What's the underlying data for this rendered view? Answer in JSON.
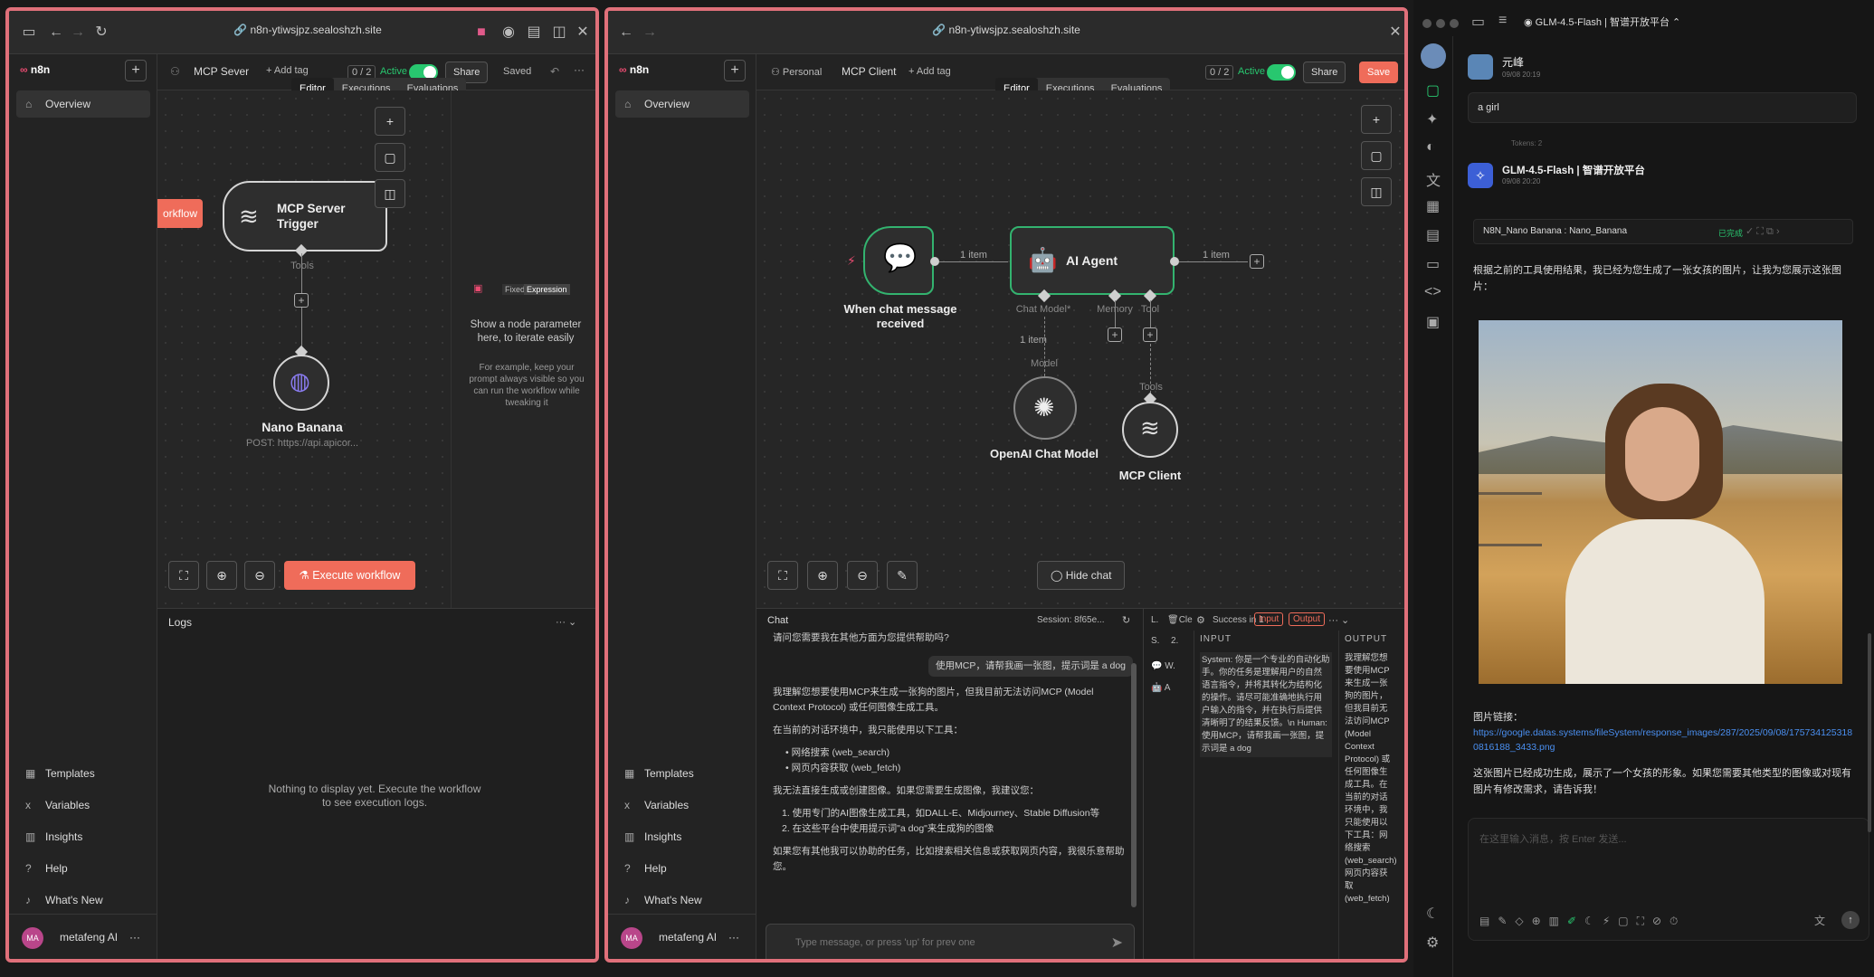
{
  "left_window": {
    "url": "n8n-ytiwsjpz.sealoshzh.site",
    "logo": "n8n",
    "nav_overview": "Overview",
    "workflow_name": "MCP Sever",
    "add_tag": "+ Add tag",
    "counter": "0 / 2",
    "active": "Active",
    "share": "Share",
    "saved": "Saved",
    "tabs": [
      "Editor",
      "Executions",
      "Evaluations"
    ],
    "workflow_tab": "orkflow",
    "node_trigger": "MCP Server Trigger",
    "tools_label": "Tools",
    "node_nano": "Nano Banana",
    "node_nano_sub": "POST: https://api.apicor...",
    "fixed": "Fixed",
    "expression": "Expression",
    "hint_title": "Show a node parameter here, to iterate easily",
    "hint_body": "For example, keep your prompt always visible so you can run the workflow while tweaking it",
    "execute": "Execute workflow",
    "logs": "Logs",
    "logs_empty": "Nothing to display yet. Execute the workflow to see execution logs.",
    "bottom_nav": [
      "Templates",
      "Variables",
      "Insights",
      "Help",
      "What's New"
    ],
    "user": "metafeng AI",
    "avatar": "MA"
  },
  "mid_window": {
    "url": "n8n-ytiwsjpz.sealoshzh.site",
    "logo": "n8n",
    "nav_overview": "Overview",
    "personal": "Personal",
    "workflow_name": "MCP Client",
    "add_tag": "+ Add tag",
    "counter": "0 / 2",
    "active": "Active",
    "share": "Share",
    "save": "Save",
    "tabs": [
      "Editor",
      "Executions",
      "Evaluations"
    ],
    "node_chat": "When chat message received",
    "item1": "1 item",
    "node_agent": "AI Agent",
    "item2": "1 item",
    "port_chat_model": "Chat Model*",
    "port_memory": "Memory",
    "port_tool": "Tool",
    "item3": "1 item",
    "model_label": "Model",
    "tools_label": "Tools",
    "node_openai": "OpenAI Chat Model",
    "node_mcp": "MCP Client",
    "hide_chat": "Hide chat",
    "chat_title": "Chat",
    "session": "Session: 8f65e...",
    "msg_bot1": "请问您需要我在其他方面为您提供帮助吗?",
    "msg_user": "使用MCP，请帮我画一张图，提示词是 a dog",
    "msg_bot2": [
      "我理解您想要使用MCP来生成一张狗的图片，但我目前无法访问MCP (Model Context Protocol) 或任何图像生成工具。",
      "在当前的对话环境中，我只能使用以下工具：",
      "• 网络搜索 (web_search)",
      "• 网页内容获取 (web_fetch)",
      "我无法直接生成或创建图像。如果您需要生成图像，我建议您：",
      "1. 使用专门的AI图像生成工具，如DALL-E、Midjourney、Stable Diffusion等",
      "2. 在这些平台中使用提示词\"a dog\"来生成狗的图像",
      "如果您有其他我可以协助的任务，比如搜索相关信息或获取网页内容，我很乐意帮助您。"
    ],
    "chat_placeholder": "Type message, or press 'up' for prev one",
    "log_l": "L.",
    "log_clear": "Cle",
    "log_success": "Success in 1",
    "btn_input": "Input",
    "btn_output": "Output",
    "input_header": "INPUT",
    "output_header": "OUTPUT",
    "tree": [
      "S.",
      "2.",
      "W.",
      "A"
    ],
    "input_text": "System: 你是一个专业的自动化助手。你的任务是理解用户的自然语言指令，并将其转化为结构化的操作。请尽可能准确地执行用户输入的指令，并在执行后提供清晰明了的结果反馈。\\n Human: 使用MCP，请帮我画一张图，提示词是 a dog",
    "output_text": "我理解您想要使用MCP来生成一张狗的图片，但我目前无法访问MCP (Model Context Protocol) 或任何图像生成工具。在当前的对话环境中，我只能使用以下工具：网络搜索 (web_search) 网页内容获取 (web_fetch)",
    "bottom_nav": [
      "Templates",
      "Variables",
      "Insights",
      "Help",
      "What's New"
    ],
    "user": "metafeng AI",
    "avatar": "MA"
  },
  "right_app": {
    "title": "GLM-4.5-Flash | 智谱开放平台",
    "user_name": "元峰",
    "user_date": "09/08 20:19",
    "user_msg": "a girl",
    "tokens": "Tokens: 2",
    "bot_name": "GLM-4.5-Flash | 智谱开放平台",
    "bot_date": "09/08 20:20",
    "tool_call": "N8N_Nano Banana : Nano_Banana",
    "tool_status": "已完成",
    "reply1": "根据之前的工具使用结果，我已经为您生成了一张女孩的图片，让我为您展示这张图片：",
    "link_label": "图片链接：",
    "link": "https://google.datas.systems/fileSystem/response_images/287/2025/09/08/1757341253180816188_3433.png",
    "reply2": "这张图片已经成功生成，展示了一个女孩的形象。如果您需要其他类型的图像或对现有图片有修改需求，请告诉我！",
    "input_placeholder": "在这里输入消息，按 Enter 发送..."
  }
}
